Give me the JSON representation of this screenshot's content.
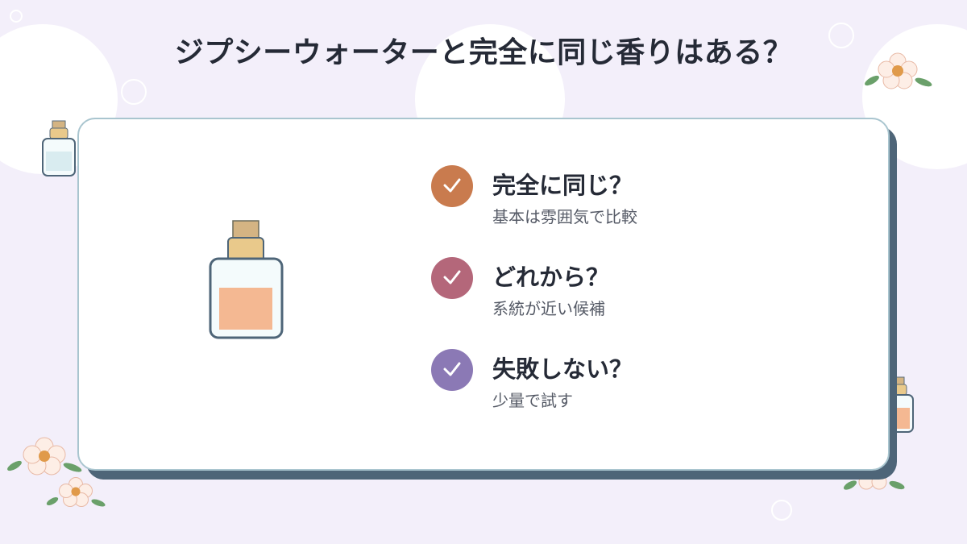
{
  "title": "ジプシーウォーターと完全に同じ香りはある？",
  "colors": {
    "background": "#f3effa",
    "card_border": "#a9c5cf",
    "card_shadow": "#4e6578",
    "title_text": "#252a36"
  },
  "items": [
    {
      "title": "完全に同じ？",
      "subtitle": "基本は雰囲気で比較",
      "icon": "check-icon",
      "color": "#c97b4e"
    },
    {
      "title": "どれから？",
      "subtitle": "系統が近い候補",
      "icon": "check-icon",
      "color": "#b4677a"
    },
    {
      "title": "失敗しない？",
      "subtitle": "少量で試す",
      "icon": "check-icon",
      "color": "#8b79b5"
    }
  ],
  "decorations": [
    "perfume-bottle-icon",
    "flower-icon",
    "bubble-icon"
  ]
}
